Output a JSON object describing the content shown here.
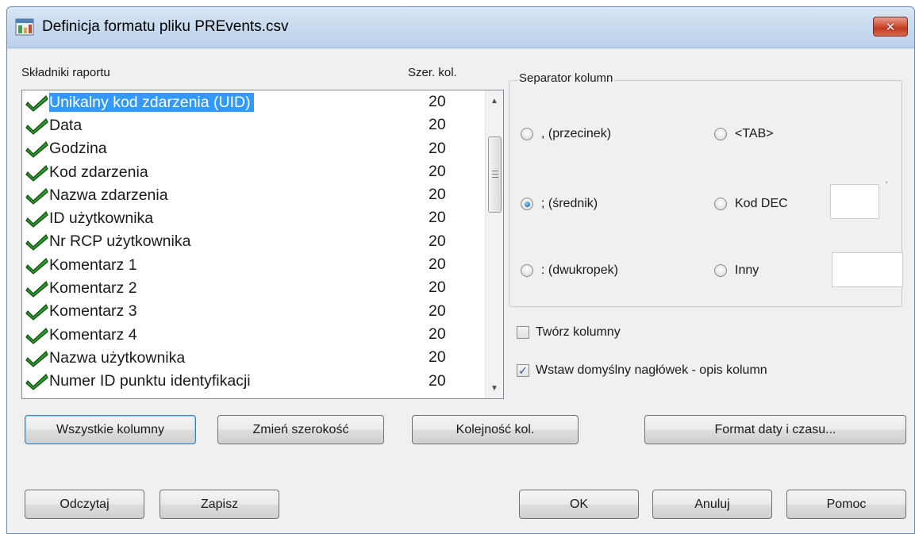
{
  "window": {
    "title": "Definicja formatu pliku PREvents.csv",
    "close_glyph": "✕",
    "app_icon": "report-format-icon"
  },
  "list": {
    "header_name": "Składniki raportu",
    "header_width": "Szer. kol.",
    "items": [
      {
        "label": "Unikalny kod zdarzenia (UID)",
        "width": "20",
        "checked": true,
        "selected": true
      },
      {
        "label": "Data",
        "width": "20",
        "checked": true
      },
      {
        "label": "Godzina",
        "width": "20",
        "checked": true
      },
      {
        "label": "Kod zdarzenia",
        "width": "20",
        "checked": true
      },
      {
        "label": "Nazwa zdarzenia",
        "width": "20",
        "checked": true
      },
      {
        "label": "ID użytkownika",
        "width": "20",
        "checked": true
      },
      {
        "label": "Nr RCP użytkownika",
        "width": "20",
        "checked": true
      },
      {
        "label": "Komentarz 1",
        "width": "20",
        "checked": true
      },
      {
        "label": "Komentarz 2",
        "width": "20",
        "checked": true
      },
      {
        "label": "Komentarz 3",
        "width": "20",
        "checked": true
      },
      {
        "label": "Komentarz 4",
        "width": "20",
        "checked": true
      },
      {
        "label": "Nazwa użytkownika",
        "width": "20",
        "checked": true
      },
      {
        "label": "Numer ID punktu identyfikacji",
        "width": "20",
        "checked": true
      }
    ],
    "selection_color": "#3399ff",
    "check_color": "#2e9a2e"
  },
  "separator": {
    "title": "Separator kolumn",
    "options": {
      "comma": {
        "label": ",  (przecinek)",
        "selected": false
      },
      "tab": {
        "label": "<TAB>",
        "selected": false
      },
      "semicolon": {
        "label": ";  (średnik)",
        "selected": true
      },
      "dec_code": {
        "label": "Kod DEC",
        "selected": false
      },
      "colon": {
        "label": ":  (dwukropek)",
        "selected": false
      },
      "other": {
        "label": "Inny",
        "selected": false
      }
    },
    "dec_value": "",
    "other_value": "",
    "dec_suffix": "'"
  },
  "options": {
    "create_columns": {
      "label": "Twórz kolumny",
      "checked": false
    },
    "insert_header": {
      "label": "Wstaw domyślny nagłówek - opis kolumn",
      "checked": true
    }
  },
  "buttons": {
    "all_columns": "Wszystkie kolumny",
    "change_width": "Zmień szerokość",
    "column_order": "Kolejność kol.",
    "date_format": "Format daty i czasu...",
    "load": "Odczytaj",
    "save": "Zapisz",
    "ok": "OK",
    "cancel": "Anuluj",
    "help": "Pomoc"
  }
}
